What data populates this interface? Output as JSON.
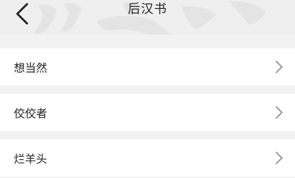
{
  "header": {
    "title": "后汉书",
    "back_icon": "chevron-left-icon"
  },
  "list": {
    "items": [
      {
        "label": "想当然"
      },
      {
        "label": "佼佼者"
      },
      {
        "label": "烂羊头"
      }
    ],
    "chevron_icon": "chevron-right-icon"
  },
  "colors": {
    "background": "#f2f2f2",
    "header_background": "#efefef",
    "row_background": "#ffffff",
    "text": "#222222",
    "chevron": "#9a9a9a"
  }
}
